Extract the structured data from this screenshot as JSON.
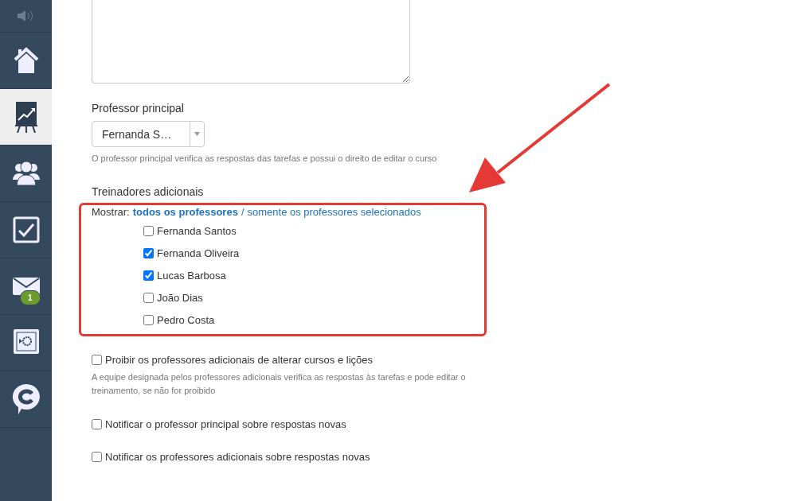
{
  "sidebar": {
    "items": [
      {
        "kind": "sound",
        "selected": false
      },
      {
        "kind": "home",
        "selected": false
      },
      {
        "kind": "chart",
        "selected": true
      },
      {
        "kind": "group",
        "selected": false
      },
      {
        "kind": "check",
        "selected": false
      },
      {
        "kind": "mail",
        "selected": false,
        "badge": "1"
      },
      {
        "kind": "safe",
        "selected": false
      },
      {
        "kind": "chat",
        "selected": false
      }
    ]
  },
  "main_teacher": {
    "label": "Professor principal",
    "value": "Fernanda S…",
    "hint": "O professor principal verifica as respostas das tarefas e possui o direito de editar o curso"
  },
  "additional_trainers": {
    "label": "Treinadores adicionais",
    "show_label": "Mostrar:",
    "separator": "/",
    "filters": [
      {
        "label": "todos os professores",
        "selected": true
      },
      {
        "label": "somente os professores selecionados",
        "selected": false
      }
    ],
    "teachers": [
      {
        "name": "Fernanda Santos",
        "checked": false
      },
      {
        "name": "Fernanda Oliveira",
        "checked": true
      },
      {
        "name": "Lucas Barbosa",
        "checked": true
      },
      {
        "name": "João Dias",
        "checked": false
      },
      {
        "name": "Pedro Costa",
        "checked": false
      }
    ]
  },
  "options": [
    {
      "label": "Proibir os professores adicionais de alterar cursos e lições",
      "checked": false,
      "hint": "A equipe designada pelos professores adicionais verifica as respostas às tarefas e pode editar o treinamento, se não for proibido"
    },
    {
      "label": "Notificar o professor principal sobre respostas novas",
      "checked": false
    },
    {
      "label": "Notificar os professores adicionais sobre respostas novas",
      "checked": false
    }
  ]
}
